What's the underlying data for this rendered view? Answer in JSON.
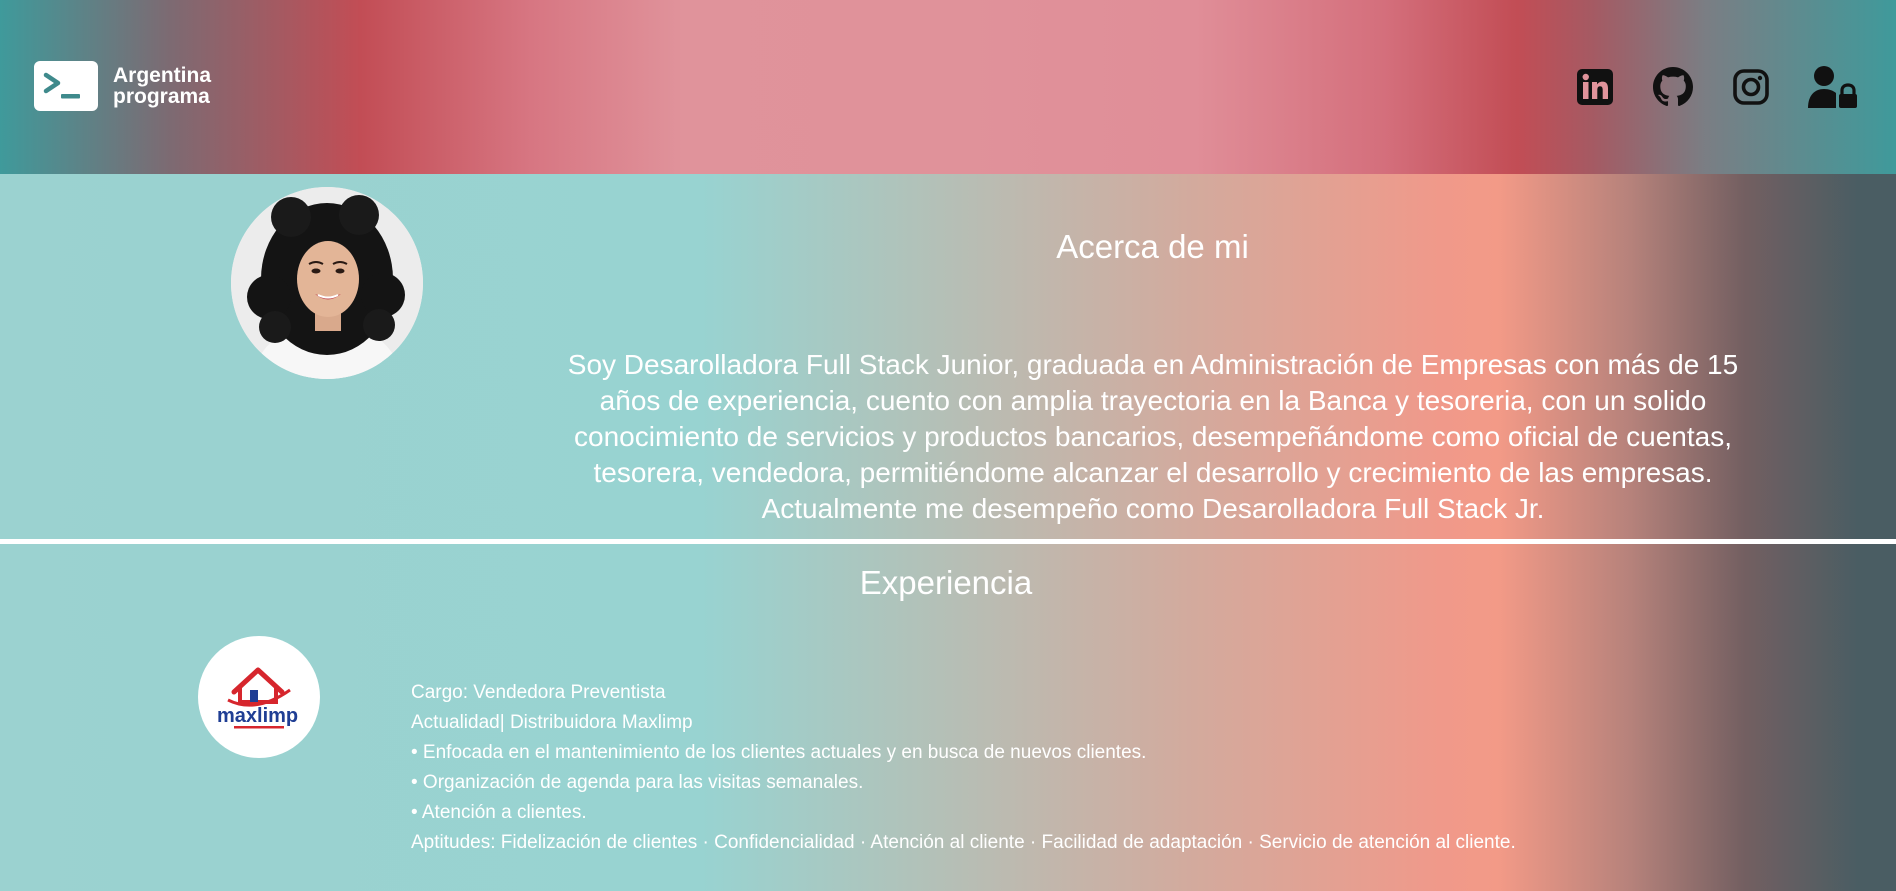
{
  "header": {
    "logo_line1": "Argentina",
    "logo_line2": "programa",
    "social_icons": [
      "linkedin-icon",
      "github-icon",
      "instagram-icon",
      "user-lock-icon"
    ]
  },
  "about": {
    "title": "Acerca de mi",
    "text": "Soy Desarolladora Full Stack Junior, graduada en Administración de Empresas con más de 15 años de experiencia, cuento con amplia trayectoria en la Banca y tesoreria, con un solido conocimiento de servicios y productos bancarios, desempeñándome como oficial de cuentas, tesorera, vendedora, permitiéndome alcanzar el desarrollo y crecimiento de las empresas. Actualmente me desempeño como Desarolladora Full Stack Jr."
  },
  "experience": {
    "title": "Experiencia",
    "company_logo_text": "maxlimp",
    "cargo": "Cargo: Vendedora Preventista",
    "periodo": "Actualidad| Distribuidora Maxlimp",
    "bullets": [
      "• Enfocada en el mantenimiento de los clientes actuales y en busca de nuevos clientes.",
      "• Organización de agenda para las visitas semanales.",
      "• Atención a clientes."
    ],
    "aptitudes": "Aptitudes: Fidelización de clientes · Confidencialidad · Atención al cliente · Facilidad de adaptación · Servicio de atención al cliente."
  },
  "colors": {
    "header_teal": "#3f9a9b",
    "header_red": "#c24d55",
    "header_pink": "#e0939b",
    "body_teal": "#98d3d1",
    "body_salmon": "#f39a87",
    "body_dark": "#4a5d63",
    "text": "#ffffff"
  }
}
